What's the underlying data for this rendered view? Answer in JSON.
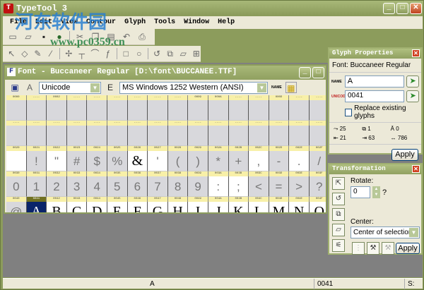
{
  "app": {
    "title": "TypeTool 3",
    "logo": "T"
  },
  "watermark": {
    "text": "河东软件园",
    "url": "www.pc0359.cn"
  },
  "menu": [
    "File",
    "Edit",
    "View",
    "Contour",
    "Glyph",
    "Tools",
    "Window",
    "Help"
  ],
  "toolbar1": [
    "new-icon",
    "open-icon",
    "save-icon",
    "save-all-icon",
    "cut-icon",
    "copy-icon",
    "paste-icon",
    "undo-icon",
    "print-icon"
  ],
  "toolbar2": [
    "pointer-icon",
    "eraser-icon",
    "pencil-icon",
    "knife-icon",
    "add-point-icon",
    "corner-icon",
    "curve-icon",
    "tangent-icon",
    "rectangle-icon",
    "ellipse-icon",
    "rotate-icon",
    "scale-icon",
    "skew-icon",
    "measure-icon"
  ],
  "fontWindow": {
    "title": "Font - Buccaneer Regular [D:\\font\\BUCCANEE.TTF]",
    "icon": "F",
    "encodingMode": "Unicode",
    "codepage": "MS Windows 1252 Western (ANSI)",
    "nameBtn": "NAME"
  },
  "grid": {
    "rows": [
      {
        "headers": [
          "0000",
          "----",
          "0002",
          "----",
          "----",
          "----",
          "----",
          "----",
          "----",
          "0009",
          "000A",
          "----",
          "----",
          "000D",
          "----",
          "----"
        ],
        "cells": [
          "",
          "",
          "",
          "",
          "",
          "",
          "",
          "",
          "",
          "",
          "",
          "",
          "",
          "",
          "",
          ""
        ]
      },
      {
        "headers": [
          "----",
          "----",
          "----",
          "----",
          "----",
          "----",
          "----",
          "----",
          "----",
          "----",
          "----",
          "----",
          "----",
          "----",
          "----",
          "----"
        ],
        "cells": [
          "",
          "",
          "",
          "",
          "",
          "",
          "",
          "",
          "",
          "",
          "",
          "",
          "",
          "",
          "",
          ""
        ]
      },
      {
        "headers": [
          "0020",
          "0021",
          "0022",
          "0023",
          "0024",
          "0025",
          "0026",
          "0027",
          "0028",
          "0029",
          "002A",
          "002B",
          "002C",
          "002D",
          "002E",
          "002F"
        ],
        "cells": [
          "",
          " !",
          "\"",
          "#",
          "$",
          "%",
          "&",
          "'",
          "(",
          ")",
          "*",
          "+",
          ",",
          "-",
          ".",
          "/"
        ]
      },
      {
        "headers": [
          "0030",
          "0031",
          "0032",
          "0033",
          "0034",
          "0035",
          "0036",
          "0037",
          "0038",
          "0039",
          "003A",
          "003B",
          "003C",
          "003D",
          "003E",
          "003F"
        ],
        "cells": [
          "0",
          "1",
          "2",
          "3",
          "4",
          "5",
          "6",
          "7",
          "8",
          "9",
          ":",
          ";",
          "<",
          "=",
          ">",
          "?"
        ]
      },
      {
        "headers": [
          "0040",
          "0041",
          "0042",
          "0043",
          "0044",
          "0045",
          "0046",
          "0047",
          "0048",
          "0049",
          "004A",
          "004B",
          "004C",
          "004D",
          "004E",
          "004F"
        ],
        "cells": [
          "@",
          "A",
          "B",
          "C",
          "D",
          "E",
          "F",
          "G",
          "H",
          "I",
          "J",
          "K",
          "L",
          "M",
          "N",
          "O"
        ]
      }
    ]
  },
  "glyphProps": {
    "title": "Glyph Properties",
    "font": "Font: Buccaneer Regular",
    "nameLabel": "NAME",
    "name": "A",
    "unicodeLabel": "UNICODE",
    "unicode": "0041",
    "replace": "Replace existing glyphs",
    "stats": {
      "points": "25",
      "contours": "1",
      "height": "0",
      "lsb": "21",
      "rsb": "63",
      "width": "786"
    },
    "apply": "Apply"
  },
  "transform": {
    "title": "Transformation",
    "rotateLabel": "Rotate:",
    "rotate": "0",
    "unit": "?",
    "centerLabel": "Center:",
    "center": "Center of selection",
    "apply": "Apply"
  },
  "status": {
    "glyph": "A",
    "code": "0041",
    "s": "S:"
  }
}
